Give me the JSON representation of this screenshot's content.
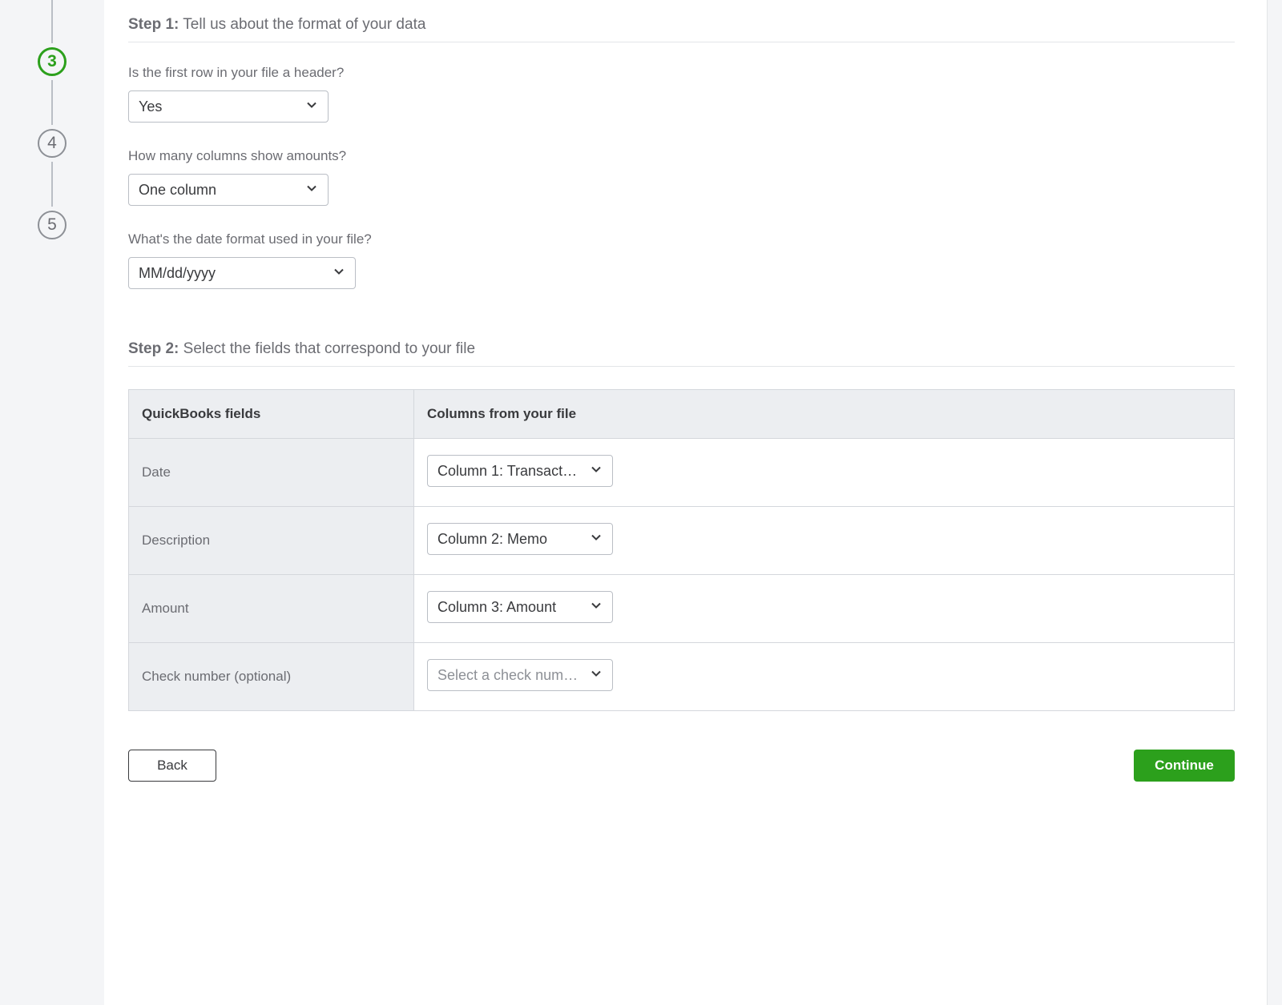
{
  "stepper": {
    "current": "3",
    "next1": "4",
    "next2": "5"
  },
  "step1": {
    "label": "Step 1:",
    "title": "Tell us about the format of your data",
    "q_header": "Is the first row in your file a header?",
    "q_header_value": "Yes",
    "q_columns": "How many columns show amounts?",
    "q_columns_value": "One column",
    "q_date": "What's the date format used in your file?",
    "q_date_value": "MM/dd/yyyy"
  },
  "step2": {
    "label": "Step 2:",
    "title": "Select the fields that correspond to your file",
    "th_qb": "QuickBooks fields",
    "th_cols": "Columns from your file",
    "rows": [
      {
        "field": "Date",
        "value": "Column 1: Transacti…",
        "placeholder": false
      },
      {
        "field": "Description",
        "value": "Column 2: Memo",
        "placeholder": false
      },
      {
        "field": "Amount",
        "value": "Column 3: Amount",
        "placeholder": false
      },
      {
        "field": "Check number (optional)",
        "value": "Select a check num…",
        "placeholder": true
      }
    ]
  },
  "buttons": {
    "back": "Back",
    "continue": "Continue"
  }
}
